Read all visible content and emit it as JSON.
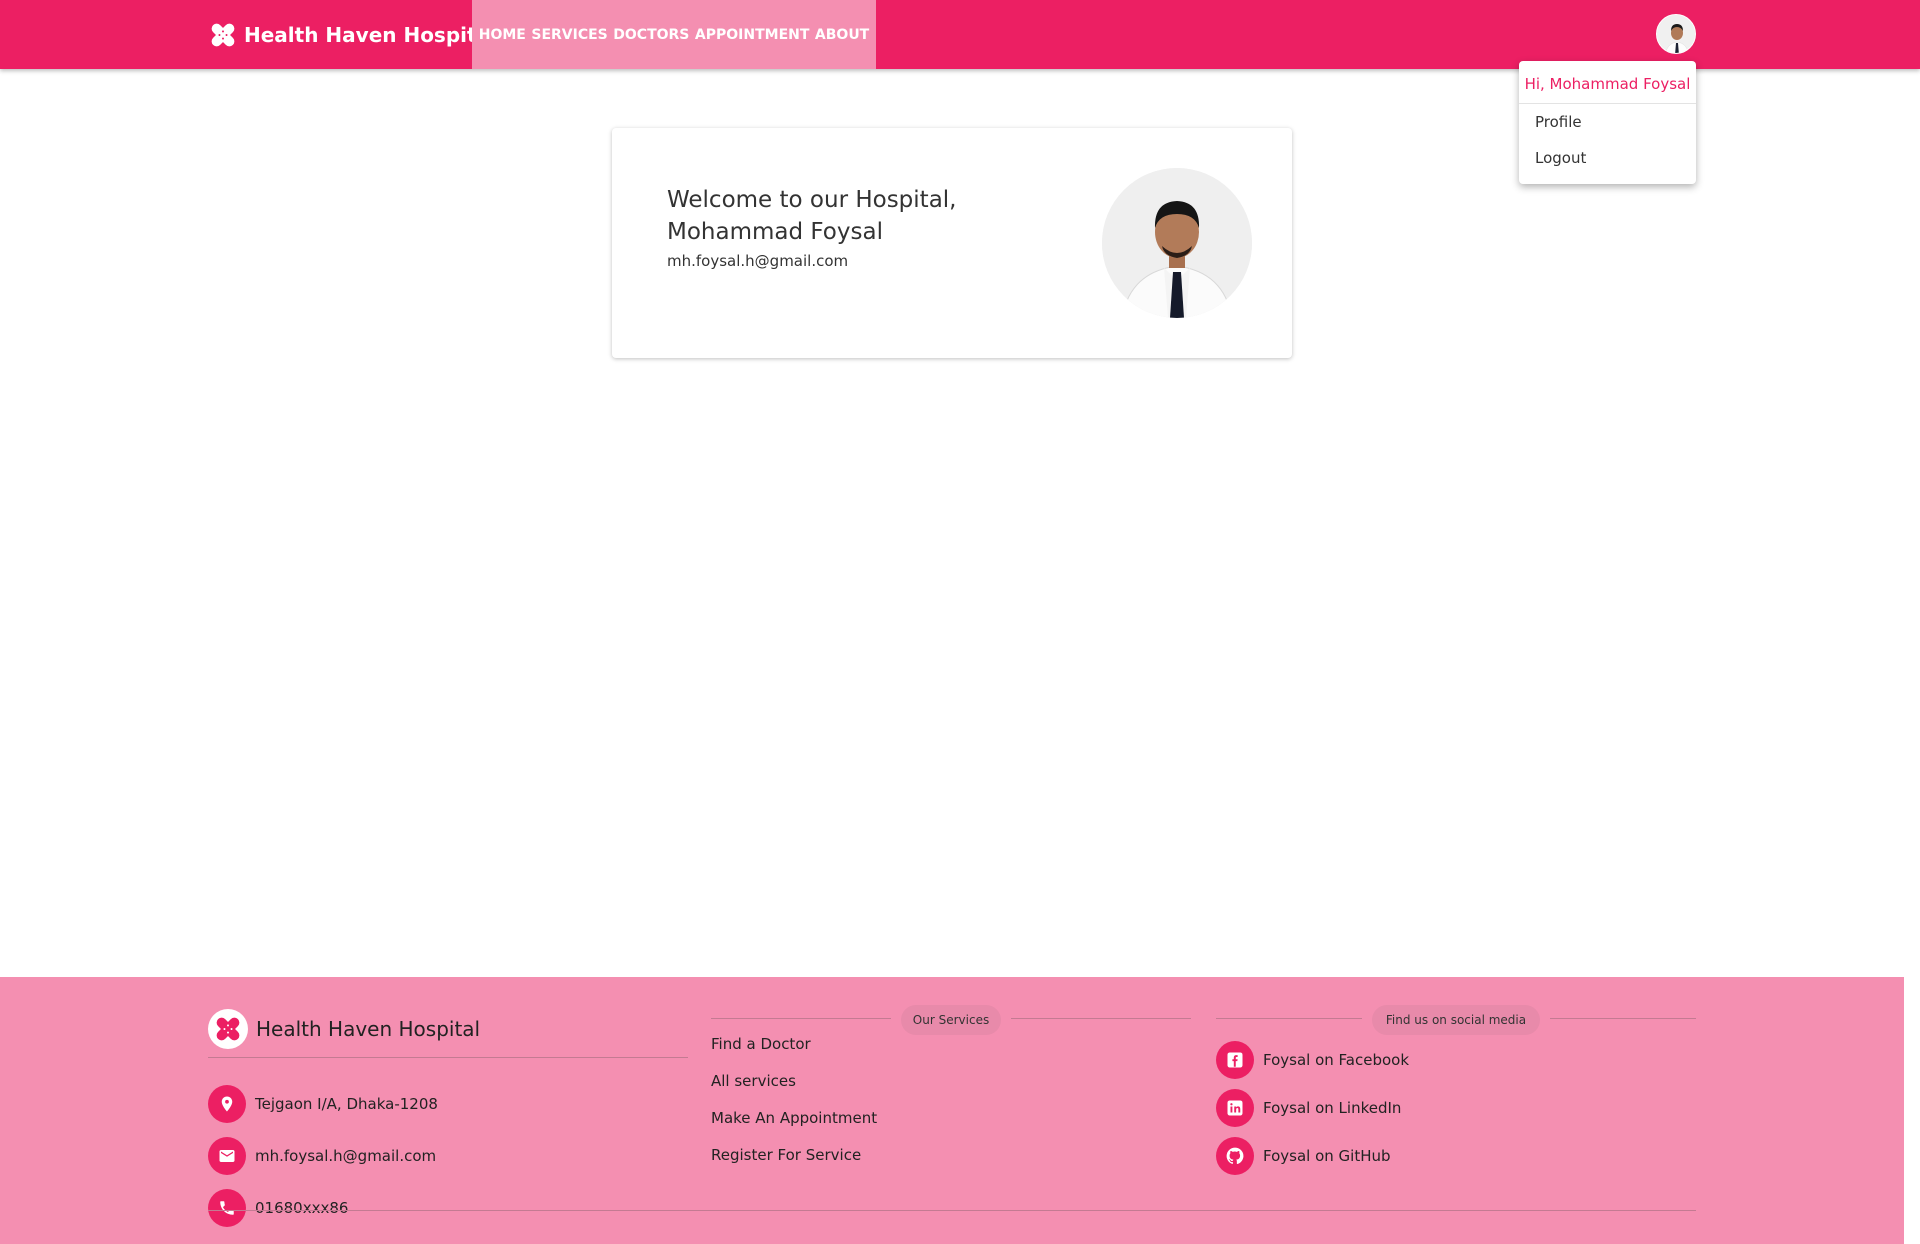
{
  "nav": {
    "brand": "Health Haven Hospital",
    "links": [
      "HOME",
      "SERVICES",
      "DOCTORS",
      "APPOINTMENT",
      "ABOUT"
    ]
  },
  "dropdown": {
    "greeting": "Hi, Mohammad Foysal",
    "items": [
      "Profile",
      "Logout"
    ]
  },
  "welcome": {
    "title": "Welcome to our Hospital, Mohammad Foysal",
    "email": "mh.foysal.h@gmail.com"
  },
  "footer": {
    "brand": "Health Haven Hospital",
    "contact": {
      "address": "Tejgaon I/A, Dhaka-1208",
      "email": "mh.foysal.h@gmail.com",
      "phone": "01680xxx86"
    },
    "services_heading": "Our Services",
    "services": [
      "Find a Doctor",
      "All services",
      "Make An Appointment",
      "Register For Service"
    ],
    "social_heading": "Find us on social media",
    "social": [
      "Foysal on Facebook",
      "Foysal on LinkedIn",
      "Foysal on GitHub"
    ]
  },
  "colors": {
    "primary": "#ec1f63",
    "light": "#f48fb1"
  }
}
